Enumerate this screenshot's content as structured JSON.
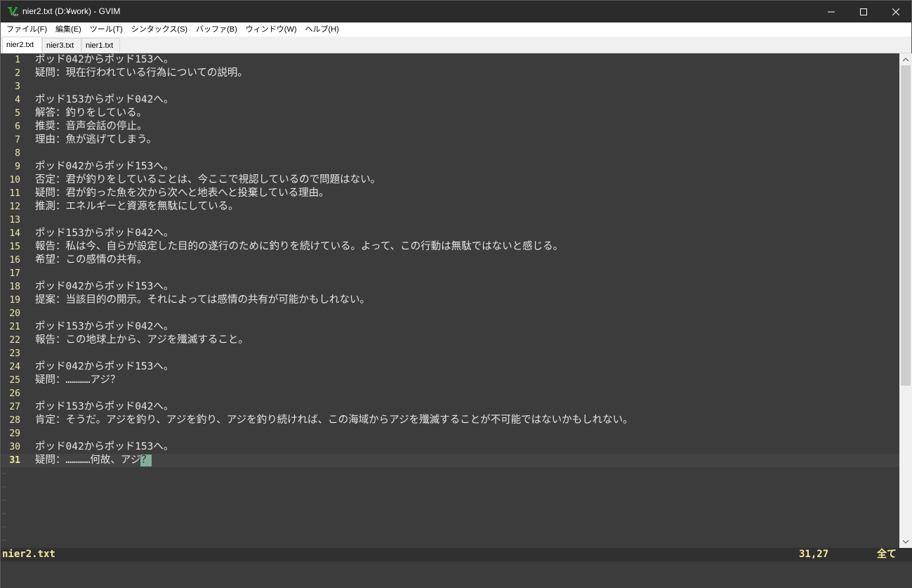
{
  "window": {
    "title": "nier2.txt (D:¥work) - GVIM",
    "app_icon": "vim-icon"
  },
  "menu": {
    "items": [
      {
        "label": "ファイル(F)"
      },
      {
        "label": "編集(E)"
      },
      {
        "label": "ツール(T)"
      },
      {
        "label": "シンタックス(S)"
      },
      {
        "label": "バッファ(B)"
      },
      {
        "label": "ウィンドウ(W)"
      },
      {
        "label": "ヘルプ(H)"
      }
    ]
  },
  "tabs": [
    {
      "label": "nier2.txt",
      "active": true
    },
    {
      "label": "nier3.txt",
      "active": false
    },
    {
      "label": "nier1.txt",
      "active": false
    }
  ],
  "editor": {
    "lines": [
      {
        "num": "1",
        "text": "ポッド042からポッド153へ。"
      },
      {
        "num": "2",
        "text": "疑問：現在行われている行為についての説明。"
      },
      {
        "num": "3",
        "text": ""
      },
      {
        "num": "4",
        "text": "ポッド153からポッド042へ。"
      },
      {
        "num": "5",
        "text": "解答：釣りをしている。"
      },
      {
        "num": "6",
        "text": "推奨：音声会話の停止。"
      },
      {
        "num": "7",
        "text": "理由：魚が逃げてしまう。"
      },
      {
        "num": "8",
        "text": ""
      },
      {
        "num": "9",
        "text": "ポッド042からポッド153へ。"
      },
      {
        "num": "10",
        "text": "否定：君が釣りをしていることは、今ここで視認しているので問題はない。"
      },
      {
        "num": "11",
        "text": "疑問：君が釣った魚を次から次へと地表へと投棄している理由。"
      },
      {
        "num": "12",
        "text": "推測：エネルギーと資源を無駄にしている。"
      },
      {
        "num": "13",
        "text": ""
      },
      {
        "num": "14",
        "text": "ポッド153からポッド042へ。"
      },
      {
        "num": "15",
        "text": "報告：私は今、自らが設定した目的の遂行のために釣りを続けている。よって、この行動は無駄ではないと感じる。"
      },
      {
        "num": "16",
        "text": "希望：この感情の共有。"
      },
      {
        "num": "17",
        "text": ""
      },
      {
        "num": "18",
        "text": "ポッド042からポッド153へ。"
      },
      {
        "num": "19",
        "text": "提案：当該目的の開示。それによっては感情の共有が可能かもしれない。"
      },
      {
        "num": "20",
        "text": ""
      },
      {
        "num": "21",
        "text": "ポッド153からポッド042へ。"
      },
      {
        "num": "22",
        "text": "報告：この地球上から、アジを殲滅すること。"
      },
      {
        "num": "23",
        "text": ""
      },
      {
        "num": "24",
        "text": "ポッド042からポッド153へ。"
      },
      {
        "num": "25",
        "text": "疑問：…………アジ？"
      },
      {
        "num": "26",
        "text": ""
      },
      {
        "num": "27",
        "text": "ポッド153からポッド042へ。"
      },
      {
        "num": "28",
        "text": "肯定：そうだ。アジを釣り、アジを釣り、アジを釣り続ければ、この海域からアジを殲滅することが不可能ではないかもしれない。"
      },
      {
        "num": "29",
        "text": ""
      },
      {
        "num": "30",
        "text": "ポッド042からポッド153へ。"
      },
      {
        "num": "31",
        "text": "疑問：…………何故、アジ",
        "cursor_char": "？",
        "current": true
      }
    ],
    "tilde": "~"
  },
  "statusline": {
    "filename": "nier2.txt",
    "position": "31,27",
    "percent": "全て"
  },
  "colors": {
    "background": "#3c3c3c",
    "line_number": "#eee8a8",
    "text": "#e5e5e5",
    "cursor": "#83ad9a",
    "statusline_bg": "#303030",
    "statusline_fg": "#f2eb9a"
  }
}
